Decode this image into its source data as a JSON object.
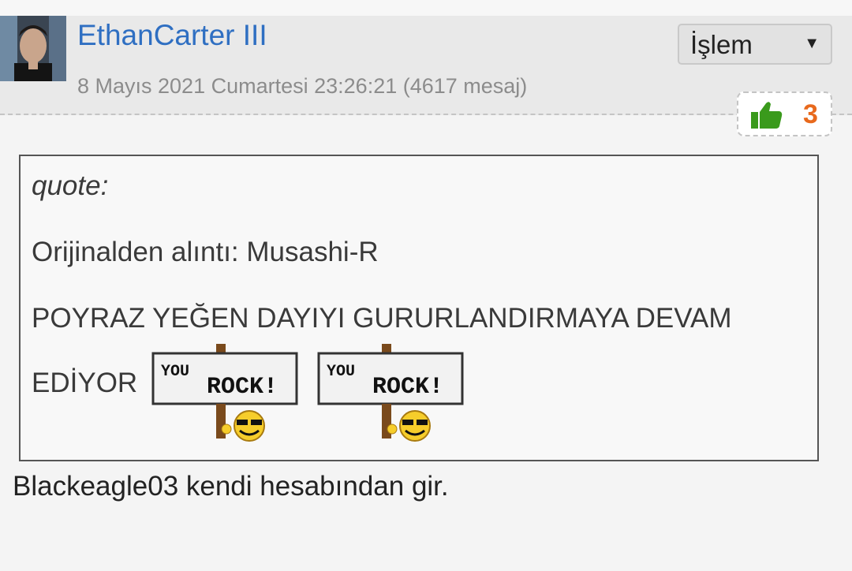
{
  "post": {
    "username": "EthanCarter III",
    "meta": "8 Mayıs 2021 Cumartesi 23:26:21 (4617 mesaj)",
    "action_label": "İşlem",
    "action_arrow": "▼",
    "likes": "3",
    "quote": {
      "title": "quote:",
      "source": "Orijinalden alıntı: Musashi-R",
      "line1": "POYRAZ YEĞEN DAYIYI GURURLANDIRMAYA DEVAM",
      "line2": "EDİYOR",
      "smiley_text_top": "YOU",
      "smiley_text_main": "ROCK!"
    },
    "reply": "Blackeagle03 kendi hesabından gir."
  },
  "colors": {
    "username": "#2f6fc2",
    "likes": "#e8691c",
    "thumb": "#3a9a1c"
  },
  "icons": [
    "avatar",
    "thumbs-up-icon",
    "chevron-down-icon",
    "you-rock-smiley"
  ]
}
